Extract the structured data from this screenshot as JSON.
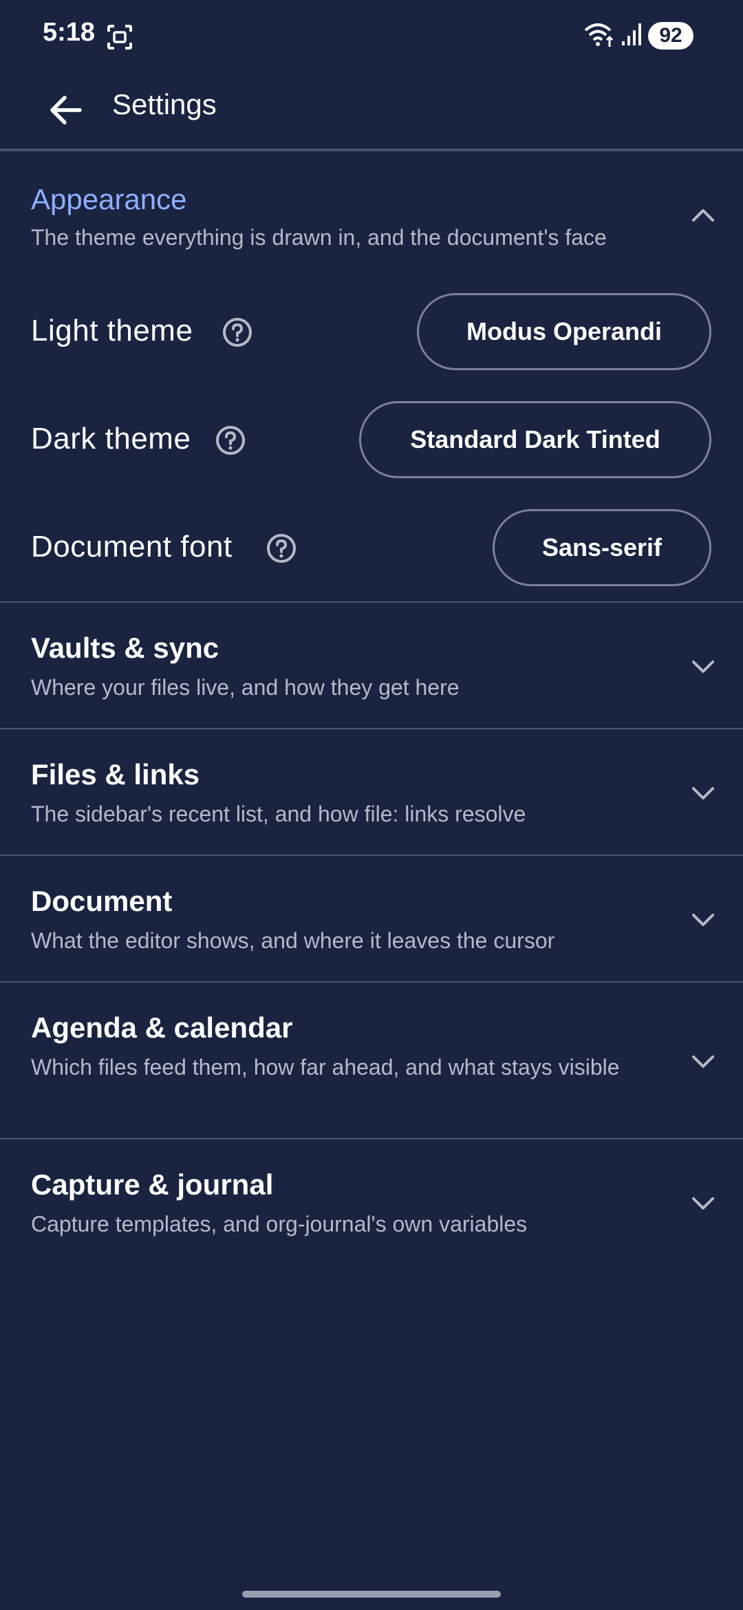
{
  "status_bar": {
    "time": "5:18",
    "battery": "92"
  },
  "app_bar": {
    "title": "Settings"
  },
  "sections": [
    {
      "title": "Appearance",
      "subtitle": "The theme everything is drawn in, and the document's face",
      "expanded": true,
      "settings": [
        {
          "label": "Light theme",
          "value": "Modus Operandi"
        },
        {
          "label": "Dark theme",
          "value": "Standard Dark Tinted"
        },
        {
          "label": "Document font",
          "value": "Sans-serif"
        }
      ]
    },
    {
      "title": "Vaults & sync",
      "subtitle": "Where your files live, and how they get here",
      "expanded": false
    },
    {
      "title": "Files & links",
      "subtitle": "The sidebar's recent list, and how file: links resolve",
      "expanded": false
    },
    {
      "title": "Document",
      "subtitle": "What the editor shows, and where it leaves the cursor",
      "expanded": false
    },
    {
      "title": "Agenda & calendar",
      "subtitle": "Which files feed them, how far ahead, and what stays visible",
      "expanded": false
    },
    {
      "title": "Capture & journal",
      "subtitle": "Capture templates, and org-journal's own variables",
      "expanded": false
    }
  ],
  "colors": {
    "background": "#1a2340",
    "accent": "#8fb0ff",
    "divider": "#4a5473",
    "secondary_text": "#b4bac8"
  }
}
